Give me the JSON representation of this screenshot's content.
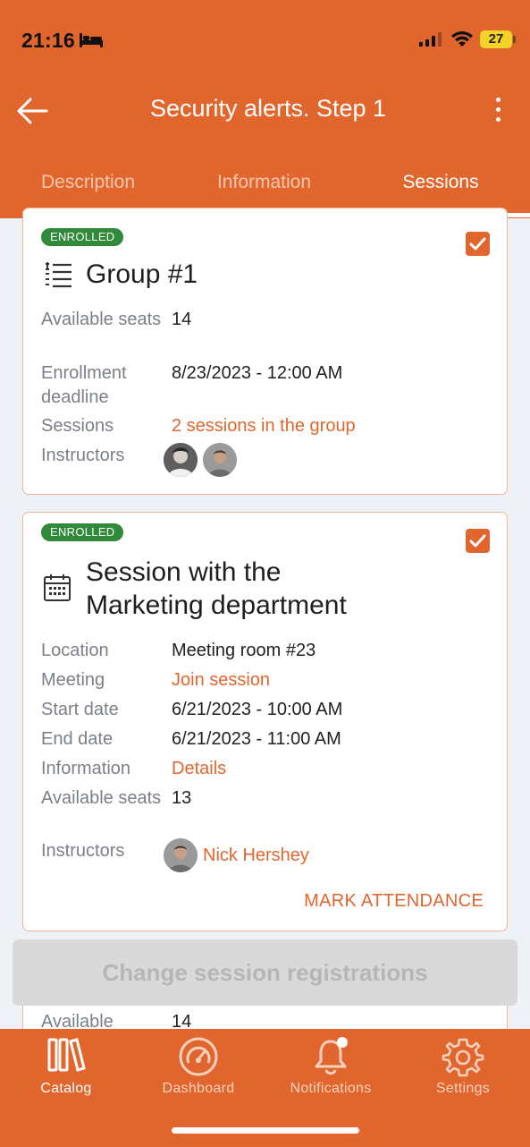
{
  "status_bar": {
    "time": "21:16",
    "battery": "27"
  },
  "header": {
    "title": "Security alerts. Step 1"
  },
  "tabs": [
    {
      "label": "Description"
    },
    {
      "label": "Information"
    },
    {
      "label": "Sessions"
    }
  ],
  "group_card": {
    "badge": "ENROLLED",
    "title": "Group #1",
    "rows": {
      "available_seats_label": "Available seats",
      "available_seats_value": "14",
      "enrollment_deadline_label": "Enrollment deadline",
      "enrollment_deadline_value": "8/23/2023 - 12:00 AM",
      "sessions_label": "Sessions",
      "sessions_value": "2 sessions in the group",
      "instructors_label": "Instructors"
    }
  },
  "session_card": {
    "badge": "ENROLLED",
    "title_line1": "Session with the",
    "title_line2": "Marketing department",
    "rows": {
      "location_label": "Location",
      "location_value": "Meeting room #23",
      "meeting_label": "Meeting",
      "meeting_value": "Join session",
      "start_date_label": "Start date",
      "start_date_value": "6/21/2023 - 10:00 AM",
      "end_date_label": "End date",
      "end_date_value": "6/21/2023 - 11:00 AM",
      "information_label": "Information",
      "information_value": "Details",
      "available_seats_label": "Available seats",
      "available_seats_value": "13",
      "instructors_label": "Instructors",
      "instructor_name": "Nick Hershey"
    },
    "mark_attendance": "MARK ATTENDANCE"
  },
  "partial_card": {
    "label": "Available",
    "value": "14"
  },
  "change_button": {
    "label": "Change session registrations"
  },
  "bottom_nav": [
    {
      "label": "Catalog",
      "icon": "catalog-icon"
    },
    {
      "label": "Dashboard",
      "icon": "dashboard-icon"
    },
    {
      "label": "Notifications",
      "icon": "bell-icon"
    },
    {
      "label": "Settings",
      "icon": "gear-icon"
    }
  ],
  "colors": {
    "accent": "#e1662e",
    "enrolled": "#2f8a3a",
    "background": "#eef2f7"
  }
}
